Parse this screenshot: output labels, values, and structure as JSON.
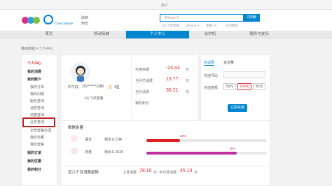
{
  "topbar": {
    "user": "用户…",
    "links": [
      "…",
      "…",
      "…"
    ]
  },
  "header": {
    "logo_sub": "China Mobile",
    "region": "陕西",
    "region2": "西安",
    "search_placeholder": "iPhone X",
    "search_button": "搜索",
    "hot_tags": [
      "4G飞享套餐",
      "IPhone X",
      "荣耀 10",
      "华为畅享"
    ]
  },
  "nav": {
    "items": [
      "首页",
      "移动商城",
      "个人中心",
      "合约机",
      "服务与支持"
    ]
  },
  "breadcrumb": "移动商城  >  个人中心",
  "sidebar": {
    "items": [
      {
        "label": "个人中心",
        "type": "title"
      },
      {
        "label": "我的消费",
        "type": "h"
      },
      {
        "label": "我的账户",
        "type": "h"
      },
      {
        "label": "我的订单",
        "type": "sub"
      },
      {
        "label": "我的问题",
        "type": "sub"
      },
      {
        "label": "服务查询",
        "type": "sub"
      },
      {
        "label": "话费查询",
        "type": "sub"
      },
      {
        "label": "流量查询",
        "type": "sub"
      },
      {
        "label": "业务查询",
        "type": "sub"
      },
      {
        "label": "全部套餐办理",
        "type": "sub"
      },
      {
        "label": "我的流量",
        "type": "sub"
      },
      {
        "label": "我的套餐",
        "type": "sub"
      },
      {
        "label": "我的订单",
        "type": "h"
      },
      {
        "label": "我的优惠",
        "type": "h"
      },
      {
        "label": "我的积分",
        "type": "h"
      }
    ]
  },
  "profile": {
    "greeting": "中午好,",
    "phone": "157******1280",
    "level_icon": "星",
    "level": "3星",
    "plan": "4G飞享套餐"
  },
  "account": {
    "rows": [
      {
        "label": "可用余额",
        "value": "-24.44",
        "unit": "元"
      },
      {
        "label": "当月已消费",
        "value": "13.77",
        "unit": "元"
      },
      {
        "label": "当月话费",
        "value": "36.21",
        "unit": "元"
      },
      {
        "label": "我的积分",
        "value": "…",
        "unit": ""
      }
    ]
  },
  "recharge": {
    "tabs": [
      "充话费",
      "充流量"
    ],
    "phone_label": "充值号码",
    "amount_label": "充值金额",
    "amounts": [
      "50元",
      "100元",
      "30元"
    ],
    "pay_button": "立即充值"
  },
  "data": {
    "title": "数据余量",
    "bars": [
      {
        "label": "语音",
        "pct": "28%",
        "fill": 0.28,
        "color": "#e02020",
        "desc": "剩余11分钟"
      },
      {
        "label": "流量",
        "pct": "75%",
        "fill": 0.75,
        "color": "#c02ea0",
        "desc": "剩余11.5GB"
      }
    ]
  },
  "spend": {
    "title": "近六个月消费趋势",
    "avg_label": "上月消费",
    "avg": "78.10",
    "avg_unit": "元",
    "avg2_label": "平均月消费",
    "avg2": "45.14",
    "avg2_unit": "元"
  }
}
